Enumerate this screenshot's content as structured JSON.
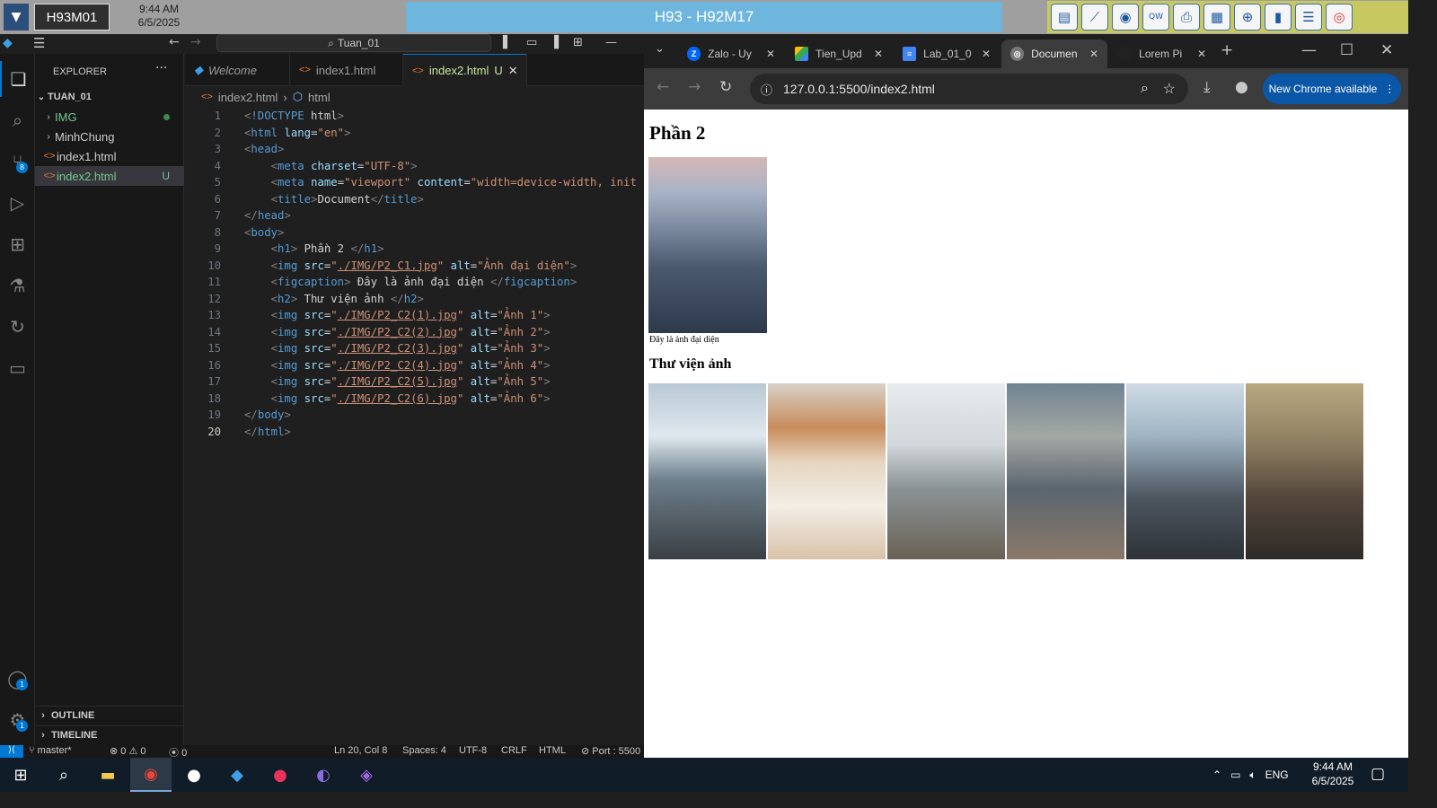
{
  "remote": {
    "machine_id": "H93M01",
    "time": "9:44 AM",
    "date": "6/5/2025",
    "session_title": "H93 - H92M17"
  },
  "vscode": {
    "search_text": "Tuan_01",
    "explorer_title": "EXPLORER",
    "workspace": "TUAN_01",
    "tree": [
      {
        "label": "IMG",
        "type": "folder"
      },
      {
        "label": "MinhChung",
        "type": "folder"
      },
      {
        "label": "index1.html",
        "type": "file"
      },
      {
        "label": "index2.html",
        "type": "file",
        "status": "U"
      }
    ],
    "outline_label": "OUTLINE",
    "timeline_label": "TIMELINE",
    "tabs": [
      {
        "label": "Welcome"
      },
      {
        "label": "index1.html"
      },
      {
        "label": "index2.html",
        "status": "U"
      }
    ],
    "breadcrumb": [
      "index2.html",
      "html"
    ],
    "source_control_badge": "8",
    "accounts_badge": "1",
    "settings_badge": "1",
    "code_lines": [
      "<!DOCTYPE html>",
      "<html lang=\"en\">",
      "<head>",
      "    <meta charset=\"UTF-8\">",
      "    <meta name=\"viewport\" content=\"width=device-width, init",
      "    <title>Document</title>",
      "</head>",
      "<body>",
      "    <h1> Phần 2 </h1>",
      "    <img src=\"./IMG/P2_C1.jpg\" alt=\"Ảnh đại diện\">",
      "    <figcaption> Đây là ảnh đại diện </figcaption>",
      "    <h2> Thư viện ảnh </h2>",
      "    <img src=\"./IMG/P2_C2(1).jpg\" alt=\"Ảnh 1\">",
      "    <img src=\"./IMG/P2_C2(2).jpg\" alt=\"Ảnh 2\">",
      "    <img src=\"./IMG/P2_C2(3).jpg\" alt=\"Ảnh 3\">",
      "    <img src=\"./IMG/P2_C2(4).jpg\" alt=\"Ảnh 4\">",
      "    <img src=\"./IMG/P2_C2(5).jpg\" alt=\"Ảnh 5\">",
      "    <img src=\"./IMG/P2_C2(6).jpg\" alt=\"Ảnh 6\">",
      "</body>",
      "</html>"
    ],
    "current_line": 20,
    "status": {
      "branch": "master*",
      "errors": "0",
      "warnings": "0",
      "ports": "0",
      "cursor": "Ln 20, Col 8",
      "spaces": "Spaces: 4",
      "encoding": "UTF-8",
      "eol": "CRLF",
      "language": "HTML",
      "port": "Port : 5500"
    }
  },
  "chrome": {
    "tabs": [
      {
        "label": "Zalo - Uy",
        "icon": "zalo"
      },
      {
        "label": "Tien_Upd",
        "icon": "drive"
      },
      {
        "label": "Lab_01_0",
        "icon": "docs"
      },
      {
        "label": "Documen",
        "icon": "globe",
        "active": true
      },
      {
        "label": "Lorem Pi",
        "icon": "blank"
      }
    ],
    "url": "127.0.0.1:5500/index2.html",
    "update_button": "New Chrome available",
    "page": {
      "h1": "Phần 2",
      "caption": "Đây là ảnh đại diện",
      "h2": "Thư viện ảnh"
    }
  },
  "taskbar": {
    "lang": "ENG",
    "time": "9:44 AM",
    "date": "6/5/2025"
  },
  "colors": {
    "vscode_bg": "#1f1f1f",
    "accent_blue": "#0078d4",
    "chrome_dark": "#3c3c3c",
    "update_button": "#0b57a7",
    "session_title_bg": "#6fb6de"
  }
}
